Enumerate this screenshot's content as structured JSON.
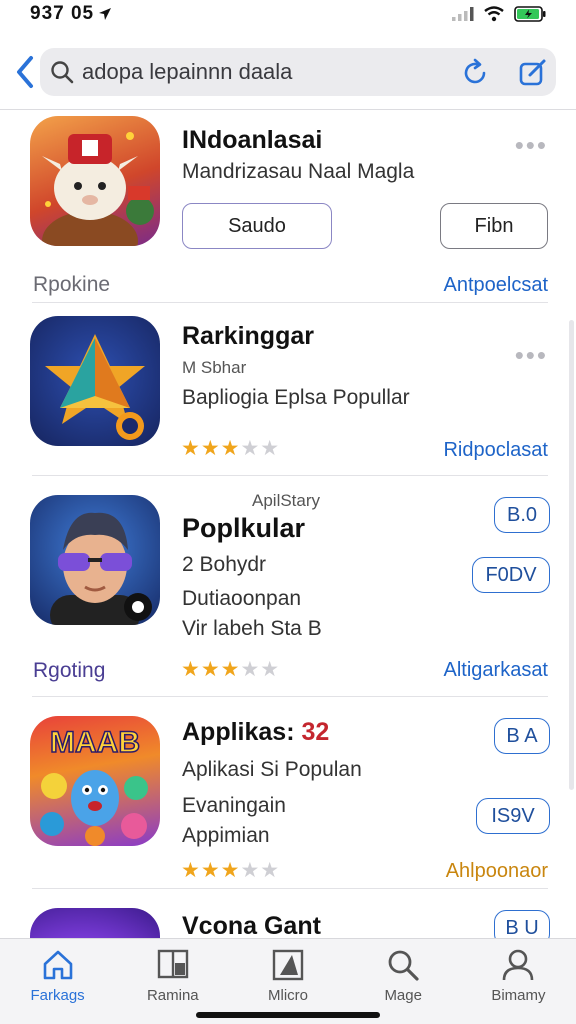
{
  "status_bar": {
    "time": "937 05",
    "battery_color": "#34c759"
  },
  "search": {
    "query": "adopa lepainnn daala",
    "icons": [
      "chevron-left-icon",
      "search-icon",
      "refresh-icon",
      "edit-icon"
    ]
  },
  "apps": [
    {
      "title": "INdoanlasai",
      "subtitle": "Mandrizasau Naal Magla",
      "primary_button": "Saudo",
      "secondary_button": "Fibn",
      "category": "Rpokine",
      "link": "Antpoelcsat",
      "has_more": true
    },
    {
      "title": "Rarkinggar",
      "meta": "M Sbhar",
      "subtitle": "Bapliogia Eplsa Popullar",
      "rating": 3,
      "link": "Ridpoclasat",
      "has_more": true
    },
    {
      "caption": "ApilStary",
      "title": "Poplkular",
      "subtitle": "2 Bohydr",
      "line3": "Dutiaoonpan",
      "line4": "Vir labeh Sta B",
      "badge": "B.0",
      "button": "F0DV",
      "category": "Rgoting",
      "rating": 3,
      "link": "Altigarkasat"
    },
    {
      "title": "Applikas:",
      "title_num": "32",
      "subtitle": "Aplikasi Si Populan",
      "line3": "Evaningain",
      "line4": "Appimian",
      "badge": "B A",
      "button": "IS9V",
      "rating": 3,
      "link": "Ahlpoonaor",
      "icon_text": "MAAB"
    },
    {
      "title": "Vcona Gant",
      "badge": "B U"
    }
  ],
  "tabs": [
    {
      "label": "Farkags",
      "icon": "home-icon",
      "active": true
    },
    {
      "label": "Ramina",
      "icon": "book-icon",
      "active": false
    },
    {
      "label": "Mlicro",
      "icon": "document-icon",
      "active": false
    },
    {
      "label": "Mage",
      "icon": "search-icon",
      "active": false
    },
    {
      "label": "Bimamy",
      "icon": "profile-icon",
      "active": false
    }
  ]
}
